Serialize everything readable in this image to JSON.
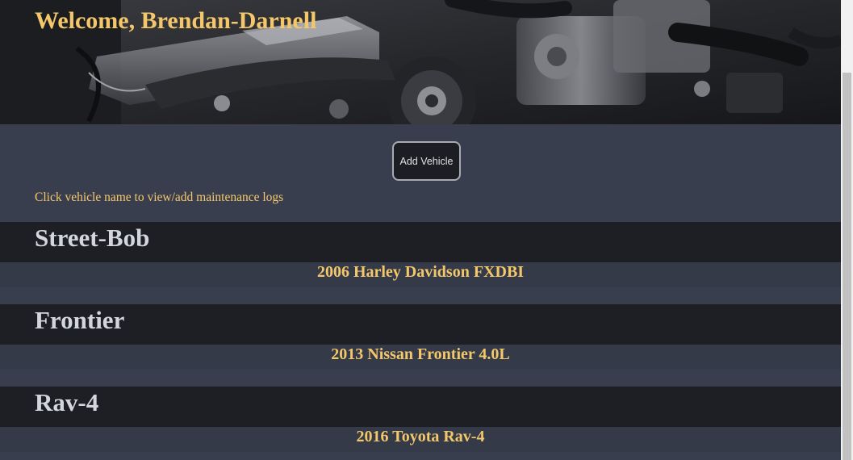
{
  "header": {
    "welcome": "Welcome, Brendan-Darnell",
    "background": "engine-photo"
  },
  "controls": {
    "add_vehicle_label": "Add Vehicle",
    "hint": "Click vehicle name to view/add maintenance logs"
  },
  "vehicles": [
    {
      "name": "Street-Bob",
      "description": "2006 Harley Davidson FXDBI"
    },
    {
      "name": "Frontier",
      "description": "2013 Nissan Frontier 4.0L"
    },
    {
      "name": "Rav-4",
      "description": "2016 Toyota Rav-4"
    }
  ],
  "colors": {
    "accent": "#f4c86a",
    "page_bg": "#393e4e",
    "name_bar": "#1e1f24",
    "desc_bar": "#343a48"
  }
}
